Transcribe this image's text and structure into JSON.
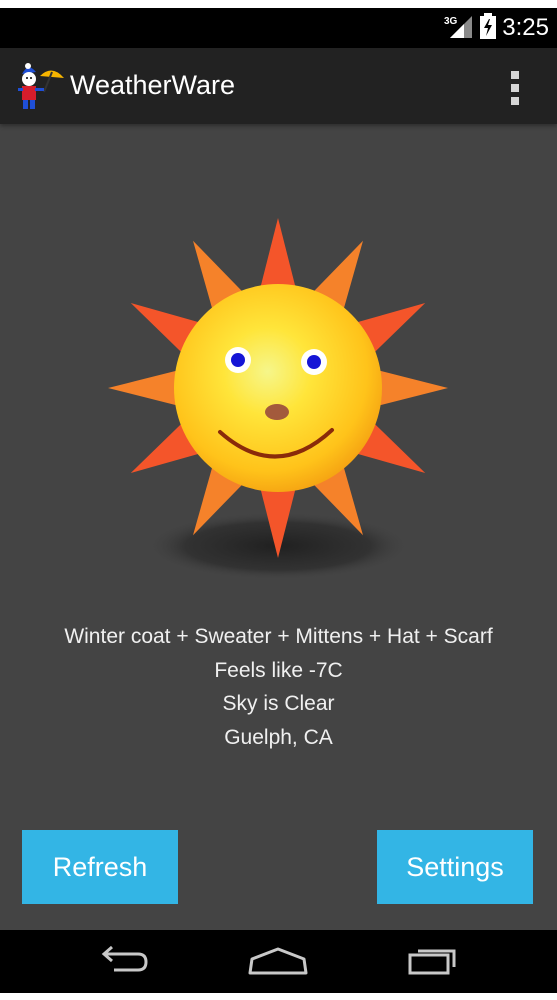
{
  "status_bar": {
    "network": "3G",
    "time": "3:25"
  },
  "action_bar": {
    "title": "WeatherWare"
  },
  "weather": {
    "clothing": "Winter coat + Sweater + Mittens + Hat + Scarf",
    "feels_like": "Feels like -7C",
    "sky": "Sky is Clear",
    "location": "Guelph, CA",
    "icon": "smiling-sun-icon"
  },
  "buttons": {
    "refresh": "Refresh",
    "settings": "Settings"
  },
  "nav": {
    "back_icon": "back-icon",
    "home_icon": "home-icon",
    "recents_icon": "recents-icon"
  },
  "colors": {
    "accent": "#33b5e5",
    "action_bar": "#222222",
    "background": "#444444",
    "status_bar": "#000000"
  }
}
